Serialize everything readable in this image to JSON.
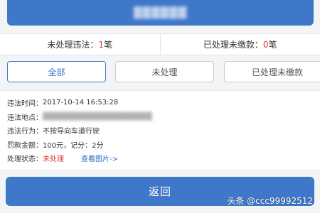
{
  "top_button": {
    "label": ""
  },
  "summary": {
    "unhandled_label": "未处理违法：",
    "unhandled_count": "1",
    "unhandled_unit": "笔",
    "paid_label": "已处理未缴款：",
    "paid_count": "0",
    "paid_unit": "笔"
  },
  "tabs": [
    {
      "label": "全部",
      "active": true
    },
    {
      "label": "未处理",
      "active": false
    },
    {
      "label": "已处理未缴款",
      "active": false
    }
  ],
  "record": {
    "time_label": "违法时间：",
    "time_value": "2017-10-14 16:53:28",
    "place_label": "违法地点：",
    "place_value": "",
    "action_label": "违法行为：",
    "action_value": "不按导向车道行驶",
    "fine_label": "罚款金额：",
    "fine_value": "100元，记分：2分",
    "status_label": "处理状态：",
    "status_value": "未处理",
    "detail_link": "查看图片->"
  },
  "back_button": {
    "label": "返回"
  },
  "watermark": "头条 @ccc99992512",
  "colors": {
    "primary": "#3f78c9",
    "alert": "#e23c3c",
    "link": "#2f6bc2"
  }
}
